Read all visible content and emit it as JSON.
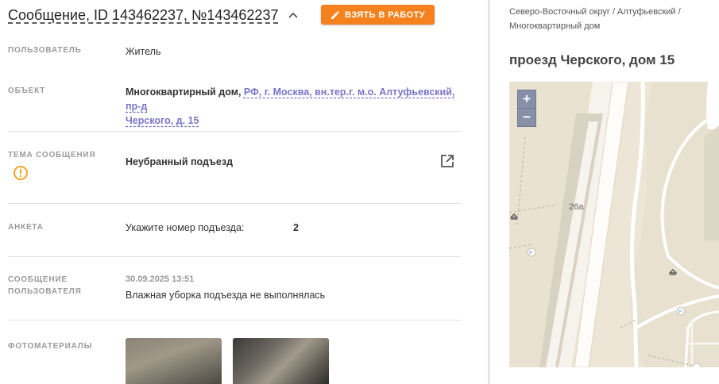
{
  "header": {
    "title": "Сообщение, ID 143462237, №143462237",
    "action_button": "ВЗЯТЬ В РАБОТУ",
    "accent_color": "#f5821f"
  },
  "fields": {
    "user": {
      "label": "ПОЛЬЗОВАТЕЛЬ",
      "value": "Житель"
    },
    "object": {
      "label": "ОБЪЕКТ",
      "type": "Многоквартирный дом,",
      "address_line1": "РФ, г. Москва, вн.тер.г. м.о. Алтуфьевский, пр-д",
      "address_line2": "Черского, д. 15"
    },
    "topic": {
      "label": "ТЕМА СООБЩЕНИЯ",
      "value": "Неубранный подъезд"
    },
    "survey": {
      "label": "АНКЕТА",
      "question": "Укажите номер подъезда:",
      "answer": "2"
    },
    "message": {
      "label_line1": "СООБЩЕНИЕ",
      "label_line2": "ПОЛЬЗОВАТЕЛЯ",
      "datetime": "30.09.2025 13:51",
      "text": "Влажная уборка подъезда не выполнялась"
    },
    "photos": {
      "label": "ФОТОМАТЕРИАЛЫ"
    }
  },
  "right_panel": {
    "breadcrumb_line1": "Северо-Восточный округ / Алтуфьевский /",
    "breadcrumb_line2": "Многоквартирный дом",
    "address_title": "проезд Черского, дом 15",
    "map": {
      "zoom_in": "+",
      "zoom_out": "−",
      "label_building": "26а"
    }
  },
  "icons": [
    "pencil-icon",
    "chevron-up-icon",
    "warning-icon",
    "external-link-icon"
  ]
}
